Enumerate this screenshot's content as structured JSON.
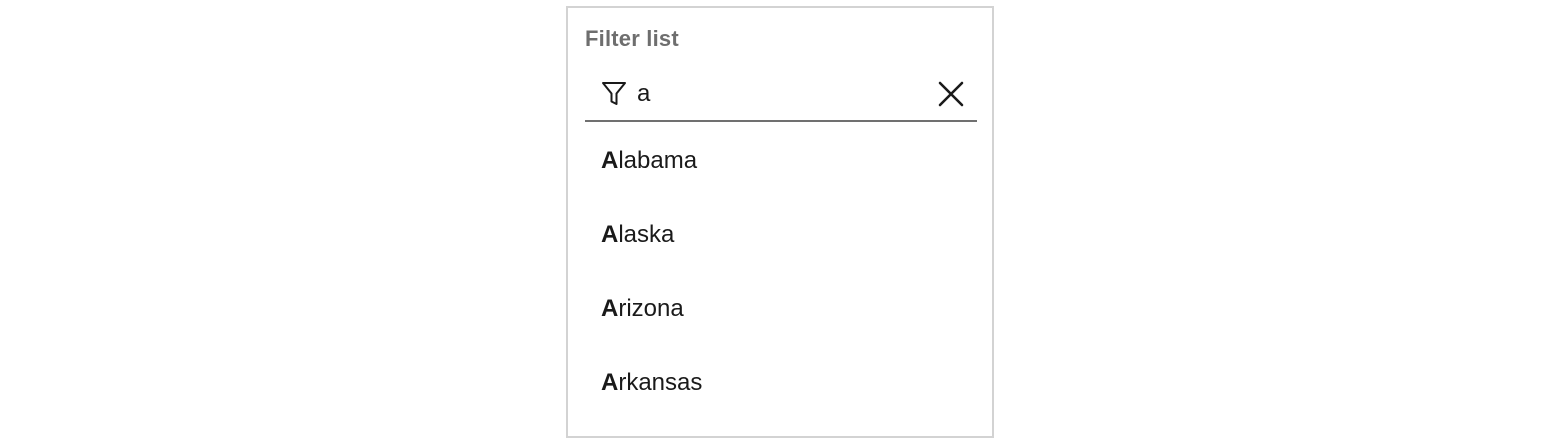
{
  "filter": {
    "label": "Filter list",
    "value": "a",
    "filter_icon": "filter-icon",
    "clear_icon": "close-icon"
  },
  "results": [
    {
      "match": "A",
      "rest": "labama"
    },
    {
      "match": "A",
      "rest": "laska"
    },
    {
      "match": "A",
      "rest": "rizona"
    },
    {
      "match": "A",
      "rest": "rkansas"
    }
  ]
}
